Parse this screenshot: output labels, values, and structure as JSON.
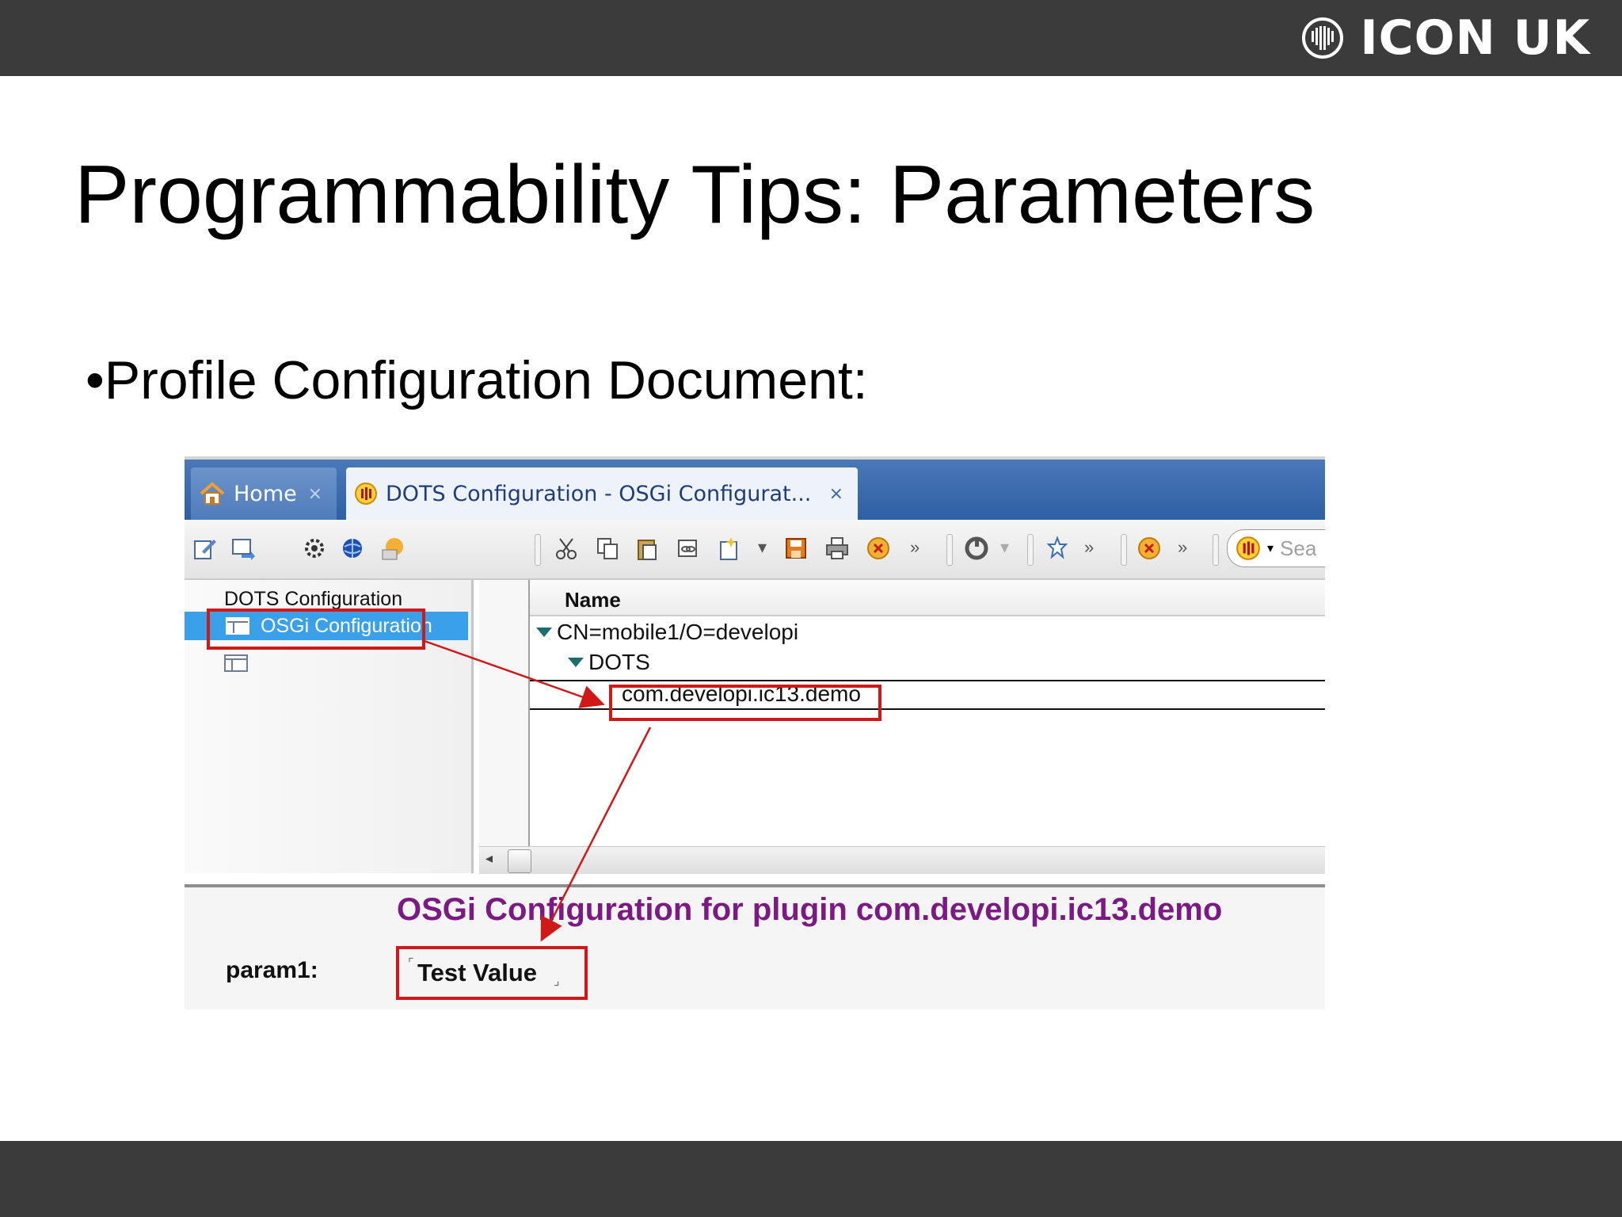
{
  "slide": {
    "brand": "ICON UK",
    "title": "Programmability Tips: Parameters",
    "bullet": "•Profile Configuration Document:"
  },
  "screenshot": {
    "tabs": [
      {
        "label": "Home",
        "close": "×",
        "icon": "home-icon"
      },
      {
        "label": "DOTS Configuration - OSGi Configurat...",
        "close": "×",
        "icon": "dots-app-icon"
      }
    ],
    "toolbar": {
      "search_placeholder": "Sea",
      "icons": [
        "edit-icon",
        "forward-icon",
        "gear-refresh-icon",
        "globe-icon",
        "folder-icon",
        "cut-icon",
        "copy-icon",
        "paste-icon",
        "link-icon",
        "new-icon",
        "save-icon",
        "print-icon",
        "stop-icon",
        "refresh-icon",
        "pin-icon",
        "stop-icon",
        "app-icon"
      ]
    },
    "navigator": {
      "header": "DOTS Configuration",
      "selected_item": "OSGi Configuration"
    },
    "view": {
      "column_name": "Name",
      "rows": [
        {
          "label": "CN=mobile1/O=developi",
          "level": 0
        },
        {
          "label": "DOTS",
          "level": 1
        },
        {
          "label": "com.developi.ic13.demo",
          "level": 2
        }
      ]
    },
    "form": {
      "title": "OSGi Configuration for plugin com.developi.ic13.demo",
      "param_label": "param1:",
      "param_value": "Test Value"
    },
    "colors": {
      "annotation": "#d01818",
      "form_title": "#7b1a82",
      "tab_strip": "#2f5fa4",
      "selection": "#3aa0ea"
    }
  }
}
